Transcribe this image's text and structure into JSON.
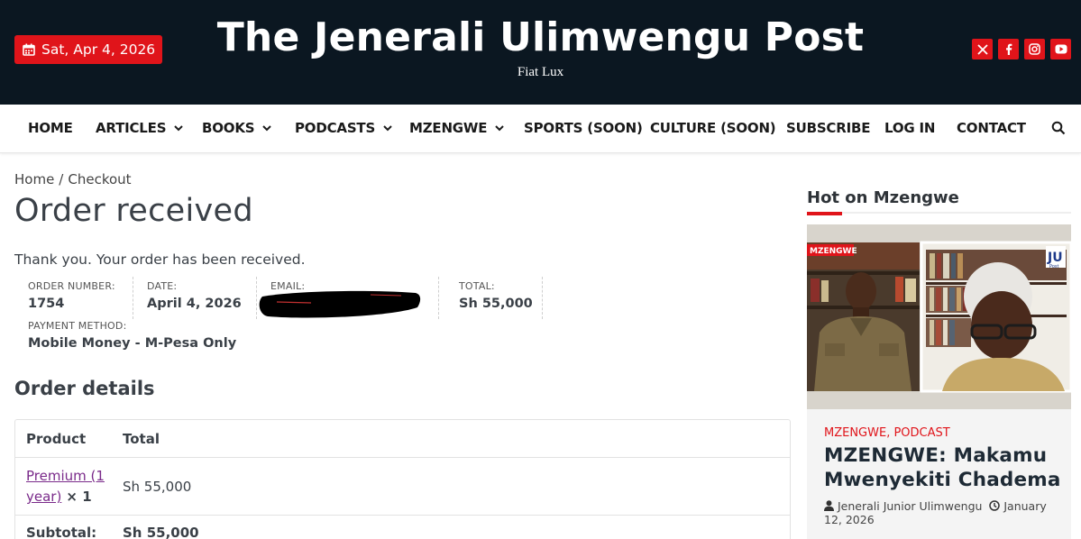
{
  "header": {
    "date": "Sat, Apr 4, 2026",
    "site_title": "The Jenerali Ulimwengu Post",
    "tagline": "Fiat Lux",
    "social_icons": [
      "x-icon",
      "facebook-icon",
      "instagram-icon",
      "youtube-icon"
    ],
    "accent_color": "#e0141a",
    "background_color": "#0b1721"
  },
  "nav": {
    "items": [
      {
        "label": "HOME",
        "dropdown": false
      },
      {
        "label": "ARTICLES",
        "dropdown": true
      },
      {
        "label": "BOOKS",
        "dropdown": true
      },
      {
        "label": "PODCASTS",
        "dropdown": true
      },
      {
        "label": "MZENGWE",
        "dropdown": true
      },
      {
        "label": "SPORTS (SOON)",
        "dropdown": false
      },
      {
        "label": "CULTURE (SOON)",
        "dropdown": false
      },
      {
        "label": "SUBSCRIBE",
        "dropdown": false
      },
      {
        "label": "LOG IN",
        "dropdown": false
      },
      {
        "label": "CONTACT",
        "dropdown": false
      }
    ],
    "search_icon": "search-icon"
  },
  "breadcrumb": {
    "home": "Home",
    "separator": "/",
    "current": "Checkout"
  },
  "page": {
    "title": "Order received",
    "thanks": "Thank you. Your order has been received."
  },
  "order_overview": {
    "order_number_label": "ORDER NUMBER:",
    "order_number": "1754",
    "date_label": "DATE:",
    "date": "April 4, 2026",
    "email_label": "EMAIL:",
    "total_label": "TOTAL:",
    "total": "Sh 55,000",
    "payment_label": "PAYMENT METHOD:",
    "payment": "Mobile Money - M-Pesa Only"
  },
  "order_details": {
    "heading": "Order details",
    "columns": [
      "Product",
      "Total"
    ],
    "items": [
      {
        "product_line1": "Premium (1",
        "product_line2": "year)",
        "qty": "× 1",
        "total": "Sh 55,000"
      }
    ],
    "subtotal_label": "Subtotal:",
    "subtotal": "Sh 55,000"
  },
  "sidebar": {
    "heading": "Hot on Mzengwe",
    "post": {
      "categories": "MZENGWE, PODCAST",
      "title": "MZENGWE: Makamu Mwenyekiti Chadema",
      "author": "Jenerali Junior Ulimwengu",
      "date": "January 12, 2026",
      "thumb_overlay_label": "MZENGWE",
      "thumb_logo_text": "JU",
      "thumb_logo_sub": "Post"
    }
  }
}
